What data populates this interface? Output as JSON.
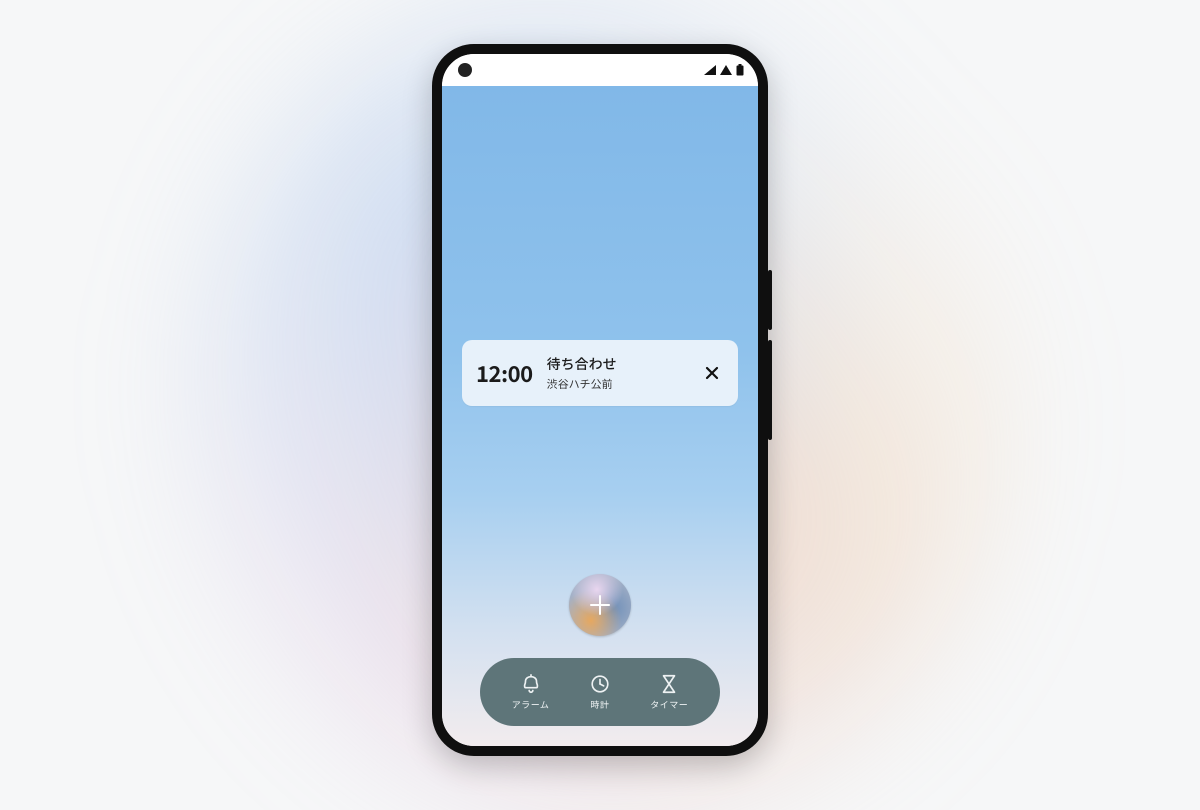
{
  "alarm_card": {
    "time": "12:00",
    "title": "待ち合わせ",
    "location": "渋谷ハチ公前"
  },
  "nav": {
    "alarm_label": "アラーム",
    "clock_label": "時計",
    "timer_label": "タイマー"
  }
}
